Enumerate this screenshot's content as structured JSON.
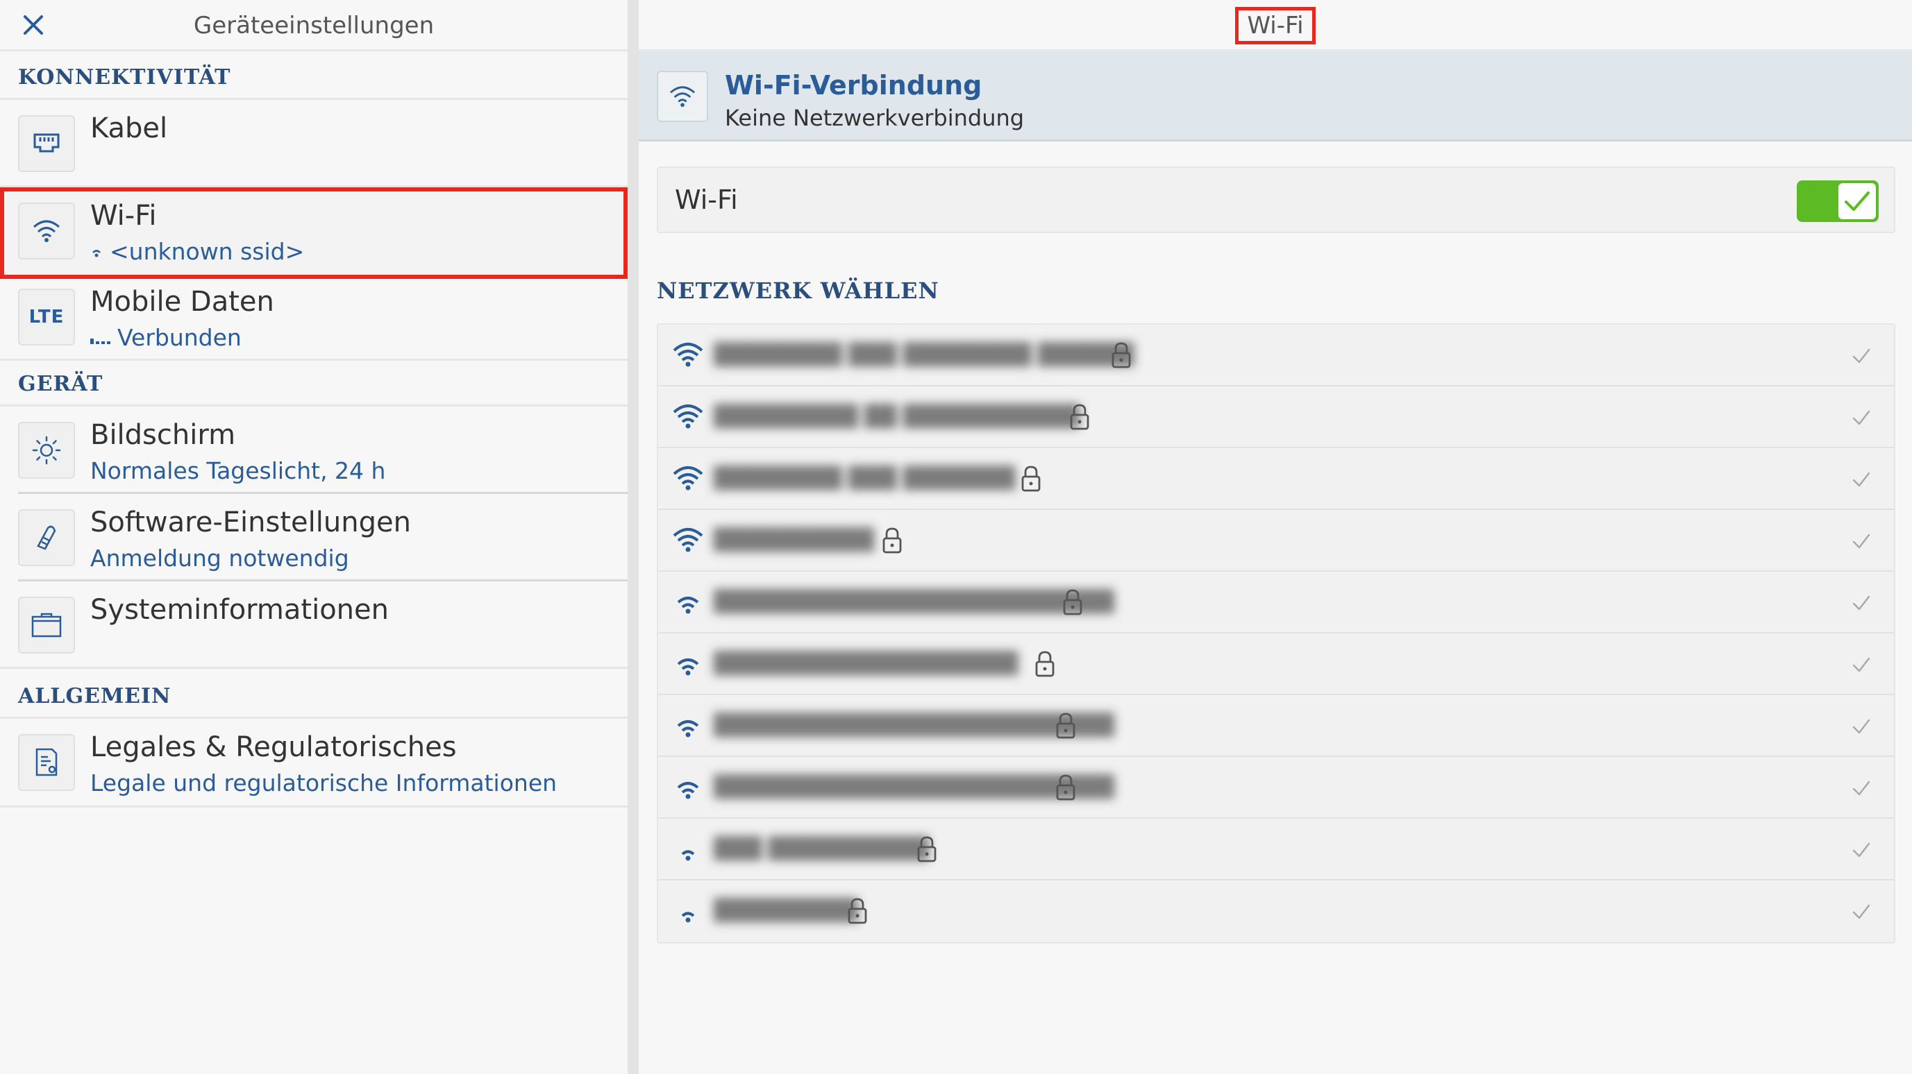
{
  "left": {
    "title": "Geräteeinstellungen",
    "close_icon": "close-icon",
    "sections": [
      {
        "header": "KONNEKTIVITÄT"
      },
      {
        "header": "GERÄT"
      },
      {
        "header": "ALLGEMEIN"
      }
    ],
    "items": {
      "cable": {
        "title": "Kabel",
        "icon": "ethernet-icon"
      },
      "wifi": {
        "title": "Wi-Fi",
        "subtitle": "<unknown ssid>",
        "icon": "wifi-icon"
      },
      "mobile": {
        "title": "Mobile Daten",
        "subtitle": "Verbunden",
        "icon_text": "LTE"
      },
      "display": {
        "title": "Bildschirm",
        "subtitle": "Normales Tageslicht, 24 h",
        "icon": "brightness-icon"
      },
      "software": {
        "title": "Software-Einstellungen",
        "subtitle": "Anmeldung notwendig",
        "icon": "software-icon"
      },
      "sysinfo": {
        "title": "Systeminformationen",
        "icon": "system-info-icon"
      },
      "legal": {
        "title": "Legales & Regulatorisches",
        "subtitle": "Legale und regulatorische Informationen",
        "icon": "legal-document-icon"
      }
    }
  },
  "right": {
    "title": "Wi-Fi",
    "connection": {
      "title": "Wi-Fi-Verbindung",
      "status": "Keine Netzwerkverbindung"
    },
    "toggle": {
      "label": "Wi-Fi",
      "enabled": true
    },
    "choose_header": "NETZWERK WÄHLEN",
    "networks": [
      {
        "ssid": "████████ ███ ████████ ██████",
        "signal": 4,
        "locked": true
      },
      {
        "ssid": "█████████ ██ ███████████",
        "signal": 4,
        "locked": true
      },
      {
        "ssid": "████████ ███ ███████",
        "signal": 4,
        "locked": true
      },
      {
        "ssid": "██████████",
        "signal": 4,
        "locked": true
      },
      {
        "ssid": "█████████████████████████",
        "signal": 3,
        "locked": true
      },
      {
        "ssid": "███████████████████",
        "signal": 3,
        "locked": true
      },
      {
        "ssid": "█████████████████████████",
        "signal": 3,
        "locked": true
      },
      {
        "ssid": "█████████████████████████",
        "signal": 3,
        "locked": true
      },
      {
        "ssid": "███ ██████████",
        "signal": 2,
        "locked": true
      },
      {
        "ssid": "█████████",
        "signal": 2,
        "locked": true
      }
    ]
  },
  "colors": {
    "accent": "#2a5c9a",
    "highlight_border": "#e8271f",
    "toggle_on": "#5cbb24"
  }
}
